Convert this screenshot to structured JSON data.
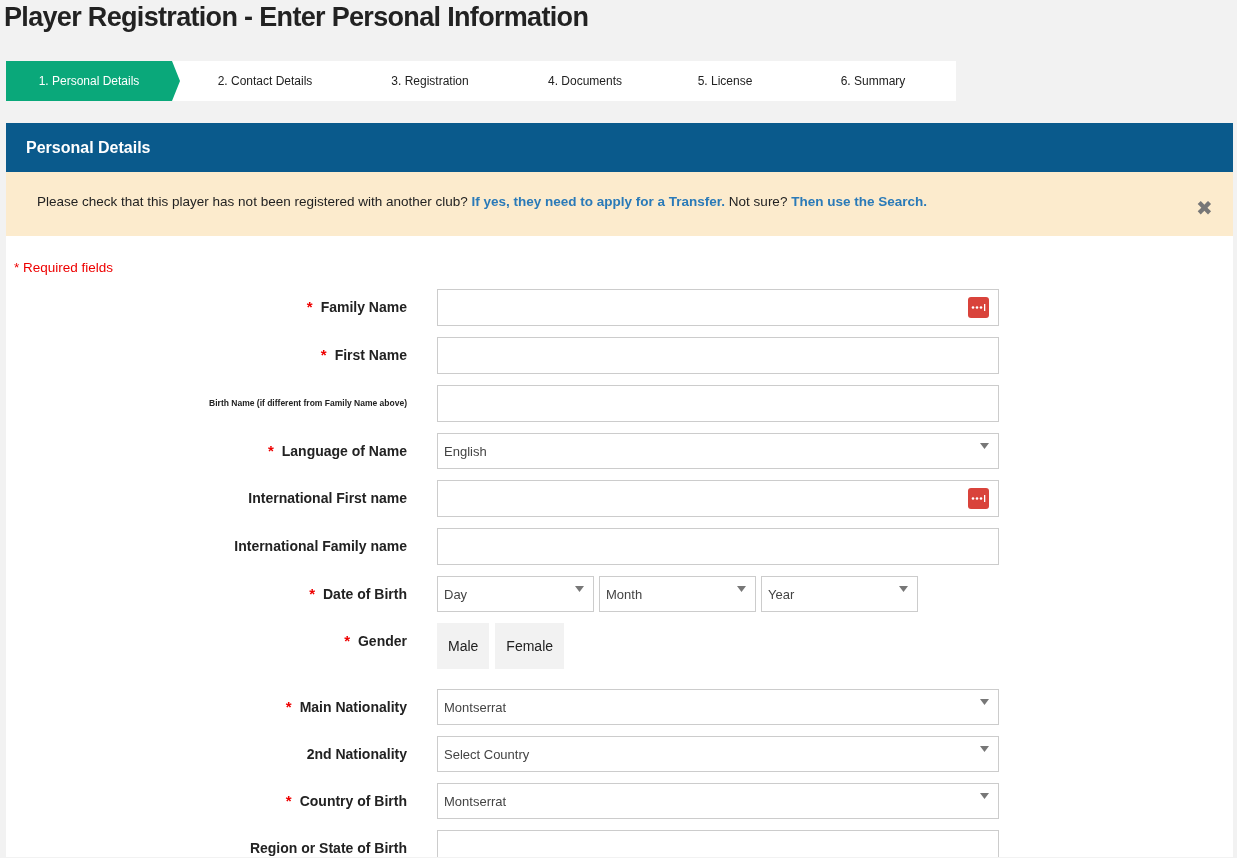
{
  "page_title": "Player Registration - Enter Personal Information",
  "steps": [
    {
      "label": "1. Personal Details",
      "selected": true
    },
    {
      "label": "2. Contact Details",
      "selected": false
    },
    {
      "label": "3. Registration",
      "selected": false
    },
    {
      "label": "4. Documents",
      "selected": false
    },
    {
      "label": "5. License",
      "selected": false
    },
    {
      "label": "6. Summary",
      "selected": false
    }
  ],
  "panel_title": "Personal Details",
  "alert": {
    "segments": [
      {
        "kind": "text",
        "text": "Please check that this player has not been registered with another club? "
      },
      {
        "kind": "link",
        "text": "If yes, they need to apply for a Transfer."
      },
      {
        "kind": "text",
        "text": " Not sure? "
      },
      {
        "kind": "link",
        "text": "Then use the Search."
      }
    ],
    "close": "✖"
  },
  "required_note": {
    "mark": "*",
    "text": "Required fields"
  },
  "fields": [
    {
      "kind": "text",
      "label": "Family Name",
      "required": true,
      "dots_icon": true
    },
    {
      "kind": "text",
      "label": "First Name",
      "required": true,
      "dots_icon": false
    },
    {
      "kind": "text",
      "label": "Birth Name (if different from Family Name above)",
      "required": false,
      "small_label": true,
      "dots_icon": false
    },
    {
      "kind": "select",
      "label": "Language of Name",
      "required": true,
      "value": "English"
    },
    {
      "kind": "text",
      "label": "International First name",
      "required": false,
      "dots_icon": true
    },
    {
      "kind": "text",
      "label": "International Family name",
      "required": false,
      "dots_icon": false
    },
    {
      "kind": "date",
      "label": "Date of Birth",
      "required": true,
      "parts": [
        "Day",
        "Month",
        "Year"
      ]
    },
    {
      "kind": "choice",
      "label": "Gender",
      "required": true,
      "options": [
        {
          "label": "Male",
          "selected": false
        },
        {
          "label": "Female",
          "selected": false
        }
      ]
    },
    {
      "kind": "select",
      "label": "Main Nationality",
      "required": true,
      "value": "Montserrat"
    },
    {
      "kind": "select",
      "label": "2nd Nationality",
      "required": false,
      "value": "Select Country"
    },
    {
      "kind": "select",
      "label": "Country of Birth",
      "required": true,
      "value": "Montserrat"
    },
    {
      "kind": "text",
      "label": "Region or State of Birth",
      "required": false,
      "dots_icon": false
    }
  ]
}
